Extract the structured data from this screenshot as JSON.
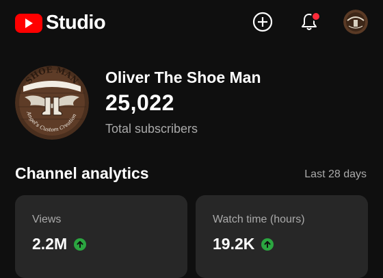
{
  "app": {
    "name": "Studio",
    "brand_color": "#ff0000"
  },
  "header": {
    "create_icon": "plus-circle-icon",
    "notifications_icon": "bell-icon",
    "notification_badge_color": "#ff2b3a",
    "account_avatar": "shoe-man-logo"
  },
  "channel": {
    "name": "Oliver The Shoe Man",
    "subscriber_count": "25,022",
    "subscriber_label": "Total subscribers",
    "avatar": {
      "top_text": "SHOE MAN",
      "bottom_text": "Angel's Custom Creations"
    }
  },
  "analytics": {
    "title": "Channel analytics",
    "period": "Last 28 days",
    "cards": [
      {
        "label": "Views",
        "value": "2.2M",
        "trend": "up"
      },
      {
        "label": "Watch time (hours)",
        "value": "19.2K",
        "trend": "up"
      }
    ],
    "trend_up_color": "#2ba640"
  }
}
